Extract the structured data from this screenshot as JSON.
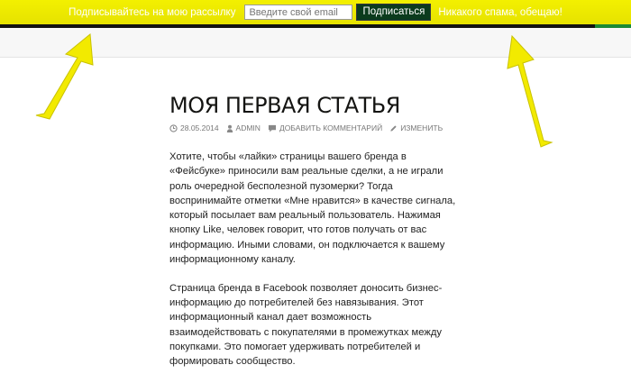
{
  "subscribe": {
    "prompt": "Подписывайтесь на мою рассылку",
    "email_placeholder": "Введите свой email",
    "button_label": "Подписаться",
    "note": "Никакого спама, обещаю!"
  },
  "colors": {
    "bar": "#f3f000",
    "button": "#0b3b1d",
    "arrow": "#f2ea00",
    "stripe_dark": "#111111",
    "stripe_green": "#1a8a34"
  },
  "article": {
    "title": "МОЯ ПЕРВАЯ СТАТЬЯ",
    "meta": {
      "date": "28.05.2014",
      "author": "ADMIN",
      "comments": "ДОБАВИТЬ КОММЕНТАРИЙ",
      "edit": "ИЗМЕНИТЬ"
    },
    "paragraphs": [
      "Хотите, чтобы «лайки» страницы вашего бренда в «Фейсбуке» приносили вам реальные сделки, а не играли роль очередной бесполезной пузомерки? Тогда воспринимайте отметки «Мне нравится» в качестве сигнала, который посылает вам реальный пользователь. Нажимая кнопку Like, человек говорит, что готов получать от вас информацию. Иными словами, он подключается к вашему информационному каналу.",
      "Страница бренда в Facebook позволяет доносить бизнес-информацию до потребителей без навязывания. Этот информационный канал дает возможность взаимодействовать с покупателями в промежутках между покупками. Это помогает удерживать потребителей и формировать сообщество."
    ]
  },
  "icons": [
    "clock-icon",
    "user-icon",
    "comment-icon",
    "pencil-icon",
    "arrow-left-icon",
    "arrow-right-icon"
  ]
}
